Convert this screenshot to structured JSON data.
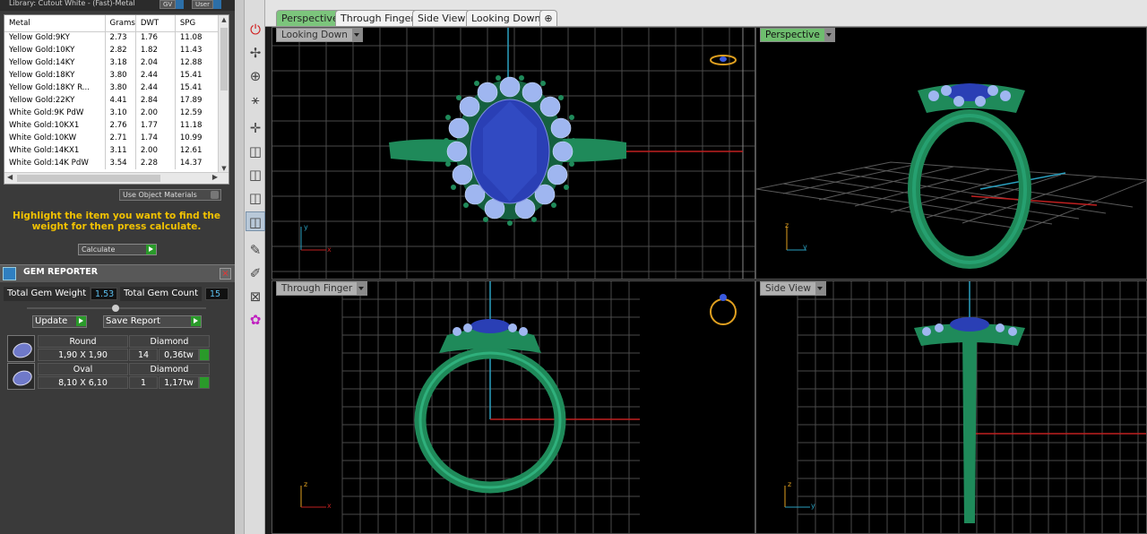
{
  "library": {
    "title": "Library: Cutout White - (Fast)-Metal",
    "btn_gv": "GV",
    "btn_user": "User"
  },
  "metal_table": {
    "columns": [
      "Metal",
      "Grams",
      "DWT",
      "SPG"
    ],
    "rows": [
      [
        "Yellow Gold:9KY",
        "2.73",
        "1.76",
        "11.08"
      ],
      [
        "Yellow Gold:10KY",
        "2.82",
        "1.82",
        "11.43"
      ],
      [
        "Yellow Gold:14KY",
        "3.18",
        "2.04",
        "12.88"
      ],
      [
        "Yellow Gold:18KY",
        "3.80",
        "2.44",
        "15.41"
      ],
      [
        "Yellow Gold:18KY R...",
        "3.80",
        "2.44",
        "15.41"
      ],
      [
        "Yellow Gold:22KY",
        "4.41",
        "2.84",
        "17.89"
      ],
      [
        "White Gold:9K PdW",
        "3.10",
        "2.00",
        "12.59"
      ],
      [
        "White Gold:10KX1",
        "2.76",
        "1.77",
        "11.18"
      ],
      [
        "White Gold:10KW",
        "2.71",
        "1.74",
        "10.99"
      ],
      [
        "White Gold:14KX1",
        "3.11",
        "2.00",
        "12.61"
      ],
      [
        "White Gold:14K PdW",
        "3.54",
        "2.28",
        "14.37"
      ]
    ]
  },
  "use_object_materials": "Use Object Materials",
  "instruction": "Highlight the item you want to find the weight for then press calculate.",
  "calculate_label": "Calculate",
  "gem_reporter": {
    "title": "GEM REPORTER",
    "total_weight_label": "Total Gem Weight",
    "total_weight_value": "1.53",
    "total_count_label": "Total Gem Count",
    "total_count_value": "15",
    "update_label": "Update",
    "save_label": "Save Report",
    "gems": [
      {
        "shape": "Round",
        "material": "Diamond",
        "size": "1,90 X 1,90",
        "count": "14",
        "weight": "0,36tw"
      },
      {
        "shape": "Oval",
        "material": "Diamond",
        "size": "8,10 X 6,10",
        "count": "1",
        "weight": "1,17tw"
      }
    ]
  },
  "tabs": [
    "Perspective",
    "Through Finger",
    "Side View",
    "Looking Down"
  ],
  "viewports": {
    "top_left": "Looking Down",
    "top_right": "Perspective",
    "bottom_left": "Through Finger",
    "bottom_right": "Side View"
  },
  "axes": {
    "tl": [
      "y",
      "x"
    ],
    "tr": [
      "z",
      "y"
    ],
    "bl": [
      "z",
      "x"
    ],
    "br": [
      "z",
      "y"
    ]
  },
  "colors": {
    "metal": "#1f8a5a",
    "gem_center": "#2a3fb5",
    "gem_side": "#9fb6f0",
    "accent_tab": "#7cc57c",
    "stat_value": "#5bc0f0"
  }
}
